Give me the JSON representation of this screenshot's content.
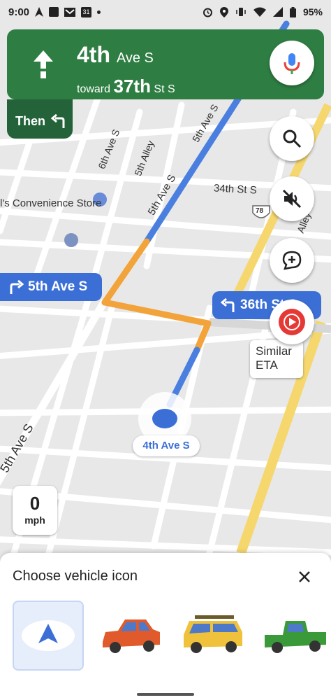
{
  "status_bar": {
    "time": "9:00",
    "battery": "95%"
  },
  "nav_banner": {
    "street_name": "4th",
    "street_suffix": "Ave S",
    "toward_label": "toward",
    "toward_name": "37th",
    "toward_suffix": "St S",
    "then_label": "Then"
  },
  "map": {
    "labels": {
      "sixth_ave": "6th Ave S",
      "fifth_alley": "5th Alley",
      "fifth_ave_upper": "5th Ave S",
      "fifth_ave_mid": "5th Ave S",
      "fifth_ave_lower": "5th Ave S",
      "thirty_fourth": "34th St S",
      "alley": "Alley",
      "convenience": "l's Convenience Store",
      "route_shield": "78",
      "partial_top": "5th Alley"
    },
    "callouts": {
      "left_turn_street": "5th Ave S",
      "right_turn_street": "36th St S"
    },
    "current_street": "4th Ave S",
    "similar_eta": [
      "Similar",
      "ETA"
    ],
    "speed_value": "0",
    "speed_unit": "mph",
    "colors": {
      "route_blue": "#4a7fe0",
      "route_orange": "#f2a33a",
      "highway_yellow": "#f5d76e",
      "nav_green": "#2e7d42"
    }
  },
  "bottom_sheet": {
    "title": "Choose vehicle icon",
    "vehicles": [
      "navigation-arrow",
      "red-sedan",
      "yellow-suv",
      "green-pickup"
    ]
  }
}
